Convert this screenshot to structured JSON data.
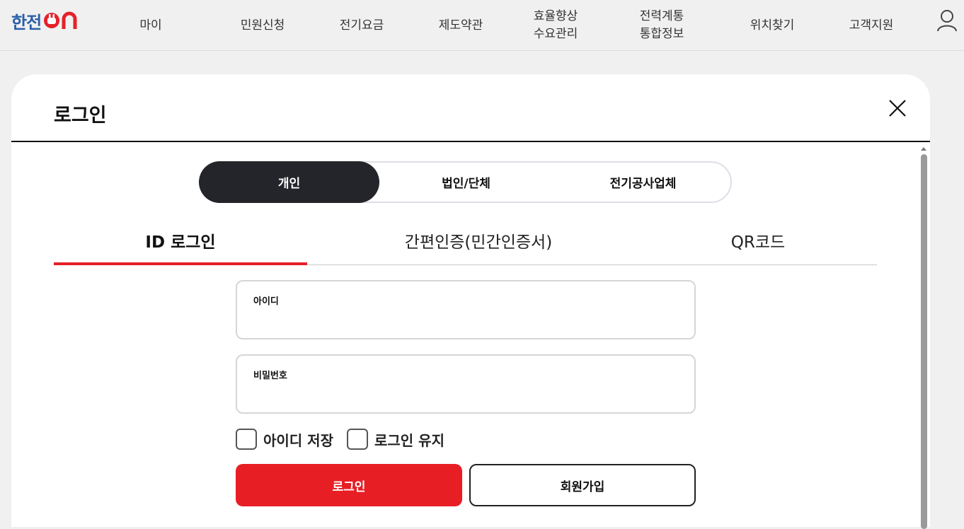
{
  "header": {
    "logo_text": "한전",
    "logo_on": "ON",
    "nav": [
      {
        "label": "마이"
      },
      {
        "label": "민원신청"
      },
      {
        "label": "전기요금"
      },
      {
        "label": "제도약관"
      },
      {
        "label": "효율향상\n수요관리"
      },
      {
        "label": "전력계통\n통합정보"
      },
      {
        "label": "위치찾기"
      },
      {
        "label": "고객지원"
      }
    ],
    "user_icon": "user-icon"
  },
  "modal": {
    "title": "로그인",
    "close_icon": "close-icon",
    "segments": [
      {
        "label": "개인",
        "active": true
      },
      {
        "label": "법인/단체",
        "active": false
      },
      {
        "label": "전기공사업체",
        "active": false
      }
    ],
    "methods": [
      {
        "label": "ID 로그인",
        "active": true
      },
      {
        "label": "간편인증(민간인증서)",
        "active": false
      },
      {
        "label": "QR코드",
        "active": false
      }
    ],
    "fields": {
      "id_label": "아이디",
      "id_value": "",
      "password_label": "비밀번호",
      "password_value": ""
    },
    "checks": {
      "save_id": "아이디 저장",
      "keep_login": "로그인 유지"
    },
    "buttons": {
      "login": "로그인",
      "signup": "회원가입"
    }
  },
  "colors": {
    "accent_red": "#e81e25",
    "segment_active": "#24252a",
    "logo_blue": "#2a5fa9",
    "logo_red": "#e5212a"
  }
}
